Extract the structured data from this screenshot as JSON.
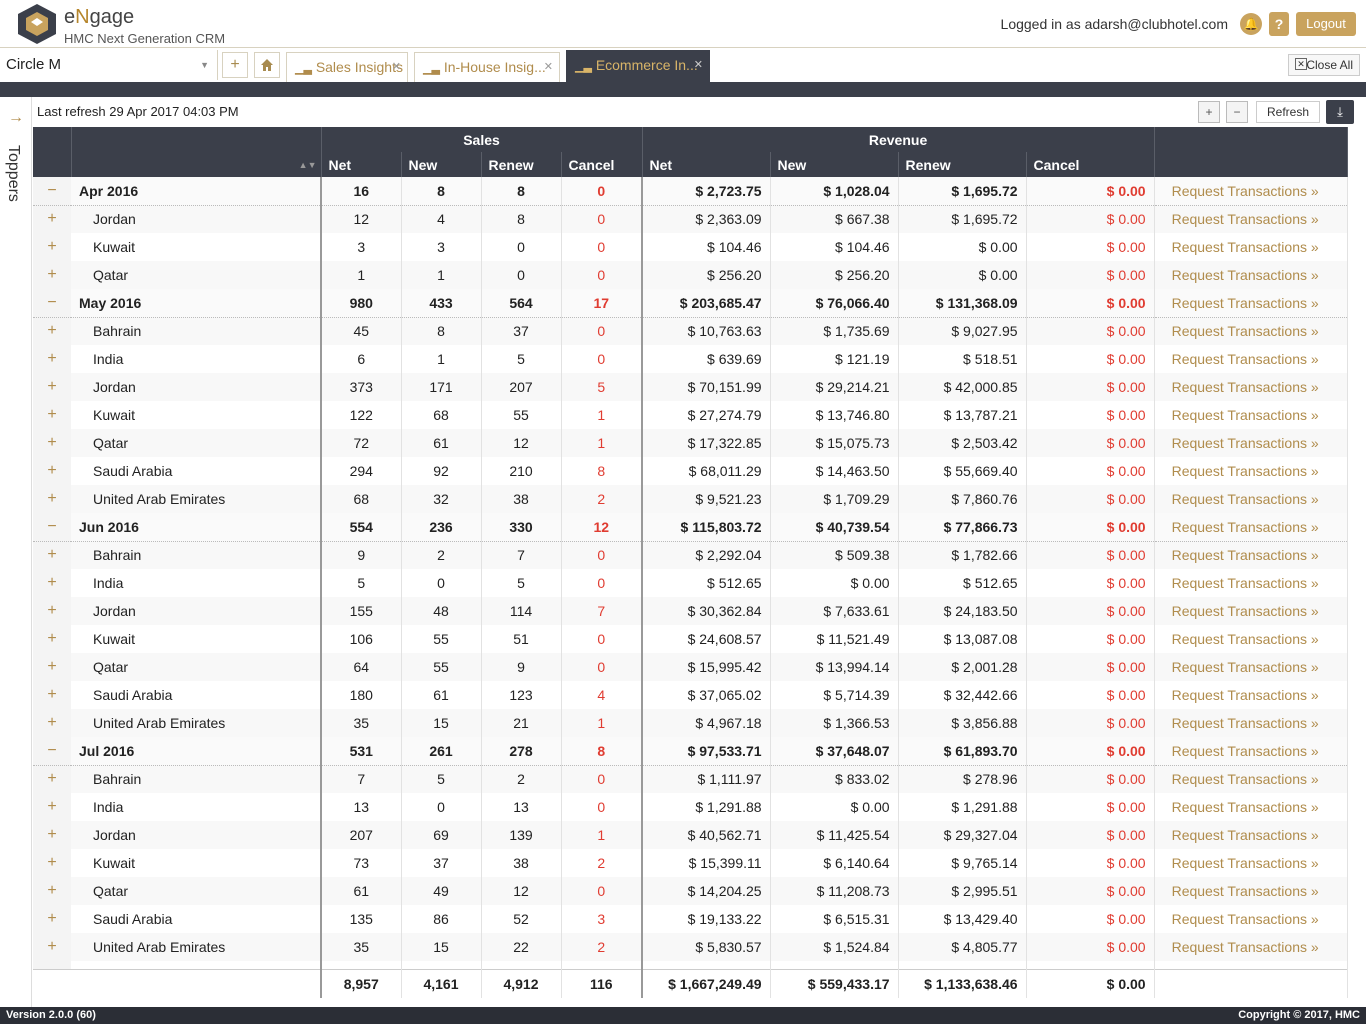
{
  "header": {
    "brand_prefix": "e",
    "brand_mid": "N",
    "brand_suffix": "gage",
    "subtitle": "HMC Next Generation CRM",
    "logged_in": "Logged in as adarsh@clubhotel.com",
    "logout_label": "Logout",
    "help_glyph": "?",
    "accent_color": "#c9a35e"
  },
  "tabbar": {
    "circle_value": "Circle M",
    "add_glyph": "+",
    "tabs": [
      {
        "label": "Sales Insights"
      },
      {
        "label": "In-House Insig..."
      },
      {
        "label": "Ecommerce In..."
      }
    ],
    "close_all_label": "Close All"
  },
  "rail": {
    "label": "Toppers",
    "arrow": "→"
  },
  "toolbar": {
    "last_refresh": "Last refresh 29 Apr 2017 04:03 PM",
    "refresh_label": "Refresh",
    "expand_glyph": "+",
    "collapse_glyph": "−"
  },
  "table": {
    "group_headers": [
      "Sales",
      "Revenue"
    ],
    "columns": [
      "Net",
      "New",
      "Renew",
      "Cancel",
      "Net",
      "New",
      "Renew",
      "Cancel"
    ],
    "link_label": "Request Transactions »",
    "rows": [
      {
        "type": "group",
        "toggle": "−",
        "name": "Apr 2016",
        "v": [
          "16",
          "8",
          "8",
          "0",
          "$ 2,723.75",
          "$ 1,028.04",
          "$ 1,695.72",
          "$ 0.00"
        ]
      },
      {
        "type": "child",
        "toggle": "+",
        "name": "Jordan",
        "v": [
          "12",
          "4",
          "8",
          "0",
          "$ 2,363.09",
          "$ 667.38",
          "$ 1,695.72",
          "$ 0.00"
        ]
      },
      {
        "type": "child",
        "toggle": "+",
        "name": "Kuwait",
        "v": [
          "3",
          "3",
          "0",
          "0",
          "$ 104.46",
          "$ 104.46",
          "$ 0.00",
          "$ 0.00"
        ]
      },
      {
        "type": "child",
        "toggle": "+",
        "name": "Qatar",
        "v": [
          "1",
          "1",
          "0",
          "0",
          "$ 256.20",
          "$ 256.20",
          "$ 0.00",
          "$ 0.00"
        ]
      },
      {
        "type": "group",
        "toggle": "−",
        "name": "May 2016",
        "v": [
          "980",
          "433",
          "564",
          "17",
          "$ 203,685.47",
          "$ 76,066.40",
          "$ 131,368.09",
          "$ 0.00"
        ]
      },
      {
        "type": "child",
        "toggle": "+",
        "name": "Bahrain",
        "v": [
          "45",
          "8",
          "37",
          "0",
          "$ 10,763.63",
          "$ 1,735.69",
          "$ 9,027.95",
          "$ 0.00"
        ]
      },
      {
        "type": "child",
        "toggle": "+",
        "name": "India",
        "v": [
          "6",
          "1",
          "5",
          "0",
          "$ 639.69",
          "$ 121.19",
          "$ 518.51",
          "$ 0.00"
        ]
      },
      {
        "type": "child",
        "toggle": "+",
        "name": "Jordan",
        "v": [
          "373",
          "171",
          "207",
          "5",
          "$ 70,151.99",
          "$ 29,214.21",
          "$ 42,000.85",
          "$ 0.00"
        ]
      },
      {
        "type": "child",
        "toggle": "+",
        "name": "Kuwait",
        "v": [
          "122",
          "68",
          "55",
          "1",
          "$ 27,274.79",
          "$ 13,746.80",
          "$ 13,787.21",
          "$ 0.00"
        ]
      },
      {
        "type": "child",
        "toggle": "+",
        "name": "Qatar",
        "v": [
          "72",
          "61",
          "12",
          "1",
          "$ 17,322.85",
          "$ 15,075.73",
          "$ 2,503.42",
          "$ 0.00"
        ]
      },
      {
        "type": "child",
        "toggle": "+",
        "name": "Saudi Arabia",
        "v": [
          "294",
          "92",
          "210",
          "8",
          "$ 68,011.29",
          "$ 14,463.50",
          "$ 55,669.40",
          "$ 0.00"
        ]
      },
      {
        "type": "child",
        "toggle": "+",
        "name": "United Arab Emirates",
        "v": [
          "68",
          "32",
          "38",
          "2",
          "$ 9,521.23",
          "$ 1,709.29",
          "$ 7,860.76",
          "$ 0.00"
        ]
      },
      {
        "type": "group",
        "toggle": "−",
        "name": "Jun 2016",
        "v": [
          "554",
          "236",
          "330",
          "12",
          "$ 115,803.72",
          "$ 40,739.54",
          "$ 77,866.73",
          "$ 0.00"
        ]
      },
      {
        "type": "child",
        "toggle": "+",
        "name": "Bahrain",
        "v": [
          "9",
          "2",
          "7",
          "0",
          "$ 2,292.04",
          "$ 509.38",
          "$ 1,782.66",
          "$ 0.00"
        ]
      },
      {
        "type": "child",
        "toggle": "+",
        "name": "India",
        "v": [
          "5",
          "0",
          "5",
          "0",
          "$ 512.65",
          "$ 0.00",
          "$ 512.65",
          "$ 0.00"
        ]
      },
      {
        "type": "child",
        "toggle": "+",
        "name": "Jordan",
        "v": [
          "155",
          "48",
          "114",
          "7",
          "$ 30,362.84",
          "$ 7,633.61",
          "$ 24,183.50",
          "$ 0.00"
        ]
      },
      {
        "type": "child",
        "toggle": "+",
        "name": "Kuwait",
        "v": [
          "106",
          "55",
          "51",
          "0",
          "$ 24,608.57",
          "$ 11,521.49",
          "$ 13,087.08",
          "$ 0.00"
        ]
      },
      {
        "type": "child",
        "toggle": "+",
        "name": "Qatar",
        "v": [
          "64",
          "55",
          "9",
          "0",
          "$ 15,995.42",
          "$ 13,994.14",
          "$ 2,001.28",
          "$ 0.00"
        ]
      },
      {
        "type": "child",
        "toggle": "+",
        "name": "Saudi Arabia",
        "v": [
          "180",
          "61",
          "123",
          "4",
          "$ 37,065.02",
          "$ 5,714.39",
          "$ 32,442.66",
          "$ 0.00"
        ]
      },
      {
        "type": "child",
        "toggle": "+",
        "name": "United Arab Emirates",
        "v": [
          "35",
          "15",
          "21",
          "1",
          "$ 4,967.18",
          "$ 1,366.53",
          "$ 3,856.88",
          "$ 0.00"
        ]
      },
      {
        "type": "group",
        "toggle": "−",
        "name": "Jul 2016",
        "v": [
          "531",
          "261",
          "278",
          "8",
          "$ 97,533.71",
          "$ 37,648.07",
          "$ 61,893.70",
          "$ 0.00"
        ]
      },
      {
        "type": "child",
        "toggle": "+",
        "name": "Bahrain",
        "v": [
          "7",
          "5",
          "2",
          "0",
          "$ 1,111.97",
          "$ 833.02",
          "$ 278.96",
          "$ 0.00"
        ]
      },
      {
        "type": "child",
        "toggle": "+",
        "name": "India",
        "v": [
          "13",
          "0",
          "13",
          "0",
          "$ 1,291.88",
          "$ 0.00",
          "$ 1,291.88",
          "$ 0.00"
        ]
      },
      {
        "type": "child",
        "toggle": "+",
        "name": "Jordan",
        "v": [
          "207",
          "69",
          "139",
          "1",
          "$ 40,562.71",
          "$ 11,425.54",
          "$ 29,327.04",
          "$ 0.00"
        ]
      },
      {
        "type": "child",
        "toggle": "+",
        "name": "Kuwait",
        "v": [
          "73",
          "37",
          "38",
          "2",
          "$ 15,399.11",
          "$ 6,140.64",
          "$ 9,765.14",
          "$ 0.00"
        ]
      },
      {
        "type": "child",
        "toggle": "+",
        "name": "Qatar",
        "v": [
          "61",
          "49",
          "12",
          "0",
          "$ 14,204.25",
          "$ 11,208.73",
          "$ 2,995.51",
          "$ 0.00"
        ]
      },
      {
        "type": "child",
        "toggle": "+",
        "name": "Saudi Arabia",
        "v": [
          "135",
          "86",
          "52",
          "3",
          "$ 19,133.22",
          "$ 6,515.31",
          "$ 13,429.40",
          "$ 0.00"
        ]
      },
      {
        "type": "child",
        "toggle": "+",
        "name": "United Arab Emirates",
        "v": [
          "35",
          "15",
          "22",
          "2",
          "$ 5,830.57",
          "$ 1,524.84",
          "$ 4,805.77",
          "$ 0.00"
        ]
      }
    ],
    "totals": [
      "8,957",
      "4,161",
      "4,912",
      "116",
      "$ 1,667,249.49",
      "$ 559,433.17",
      "$ 1,133,638.46",
      "$ 0.00"
    ]
  },
  "footer": {
    "version": "Version 2.0.0 (60)",
    "copyright": "Copyright © 2017, HMC"
  }
}
